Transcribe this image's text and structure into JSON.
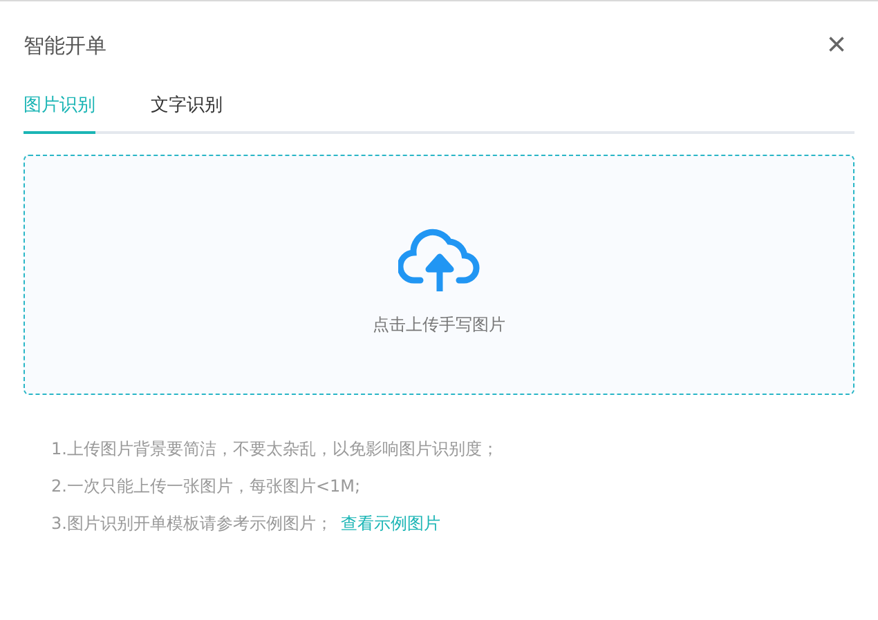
{
  "dialog": {
    "title": "智能开单",
    "close": "×"
  },
  "tabs": [
    {
      "label": "图片识别",
      "selected": true
    },
    {
      "label": "文字识别",
      "selected": false
    }
  ],
  "upload": {
    "label": "点击上传手写图片"
  },
  "notes": [
    {
      "text": "1.上传图片背景要简洁，不要太杂乱，以免影响图片识别度；"
    },
    {
      "text": "2.一次只能上传一张图片，每张图片<1M;"
    },
    {
      "text": "3.图片识别开单模板请参考示例图片；",
      "link": "查看示例图片"
    }
  ]
}
